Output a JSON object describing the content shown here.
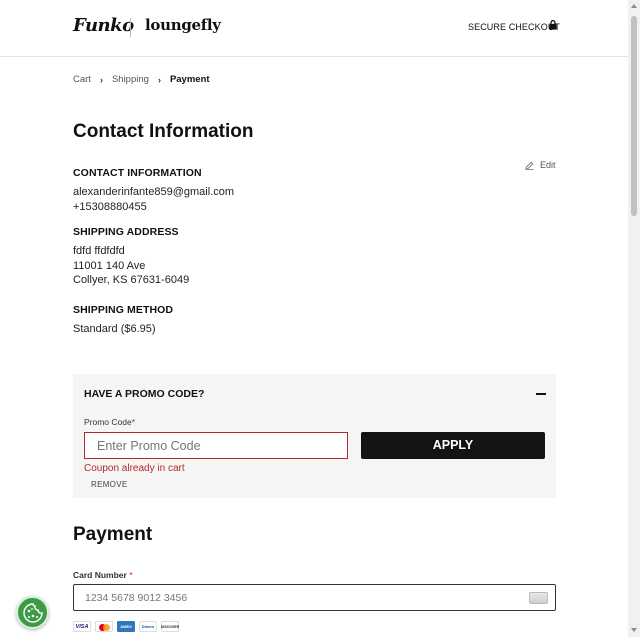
{
  "header": {
    "brand_primary": "Funko",
    "brand_secondary": "loungefly",
    "secure_label": "SECURE CHECKOUT"
  },
  "breadcrumb": {
    "items": [
      "Cart",
      "Shipping",
      "Payment"
    ]
  },
  "page_title": "Contact Information",
  "edit_label": "Edit",
  "contact": {
    "title": "CONTACT INFORMATION",
    "email": "alexanderinfante859@gmail.com",
    "phone": "+15308880455"
  },
  "shipping_address": {
    "title": "SHIPPING ADDRESS",
    "name": "fdfd ffdfdfd",
    "street": "11001 140 Ave",
    "city_line": "Collyer, KS 67631-6049"
  },
  "shipping_method": {
    "title": "SHIPPING METHOD",
    "value": "Standard ($6.95)"
  },
  "promo": {
    "title": "HAVE A PROMO CODE?",
    "label": "Promo Code",
    "required_mark": "*",
    "placeholder": "Enter Promo Code",
    "value": "",
    "apply_label": "APPLY",
    "error": "Coupon already in cart",
    "remove_label": "REMOVE"
  },
  "payment": {
    "title": "Payment",
    "card_label": "Card Number",
    "required_mark": "*",
    "card_placeholder": "1234 5678 9012 3456",
    "brands": [
      "VISA",
      "mastercard",
      "AMEX",
      "Diners",
      "DISCOVER"
    ]
  },
  "colors": {
    "accent_dark": "#141414",
    "error": "#b42b2b",
    "promo_bg": "#f5f5f5",
    "cookie_green": "#3f9a47"
  }
}
